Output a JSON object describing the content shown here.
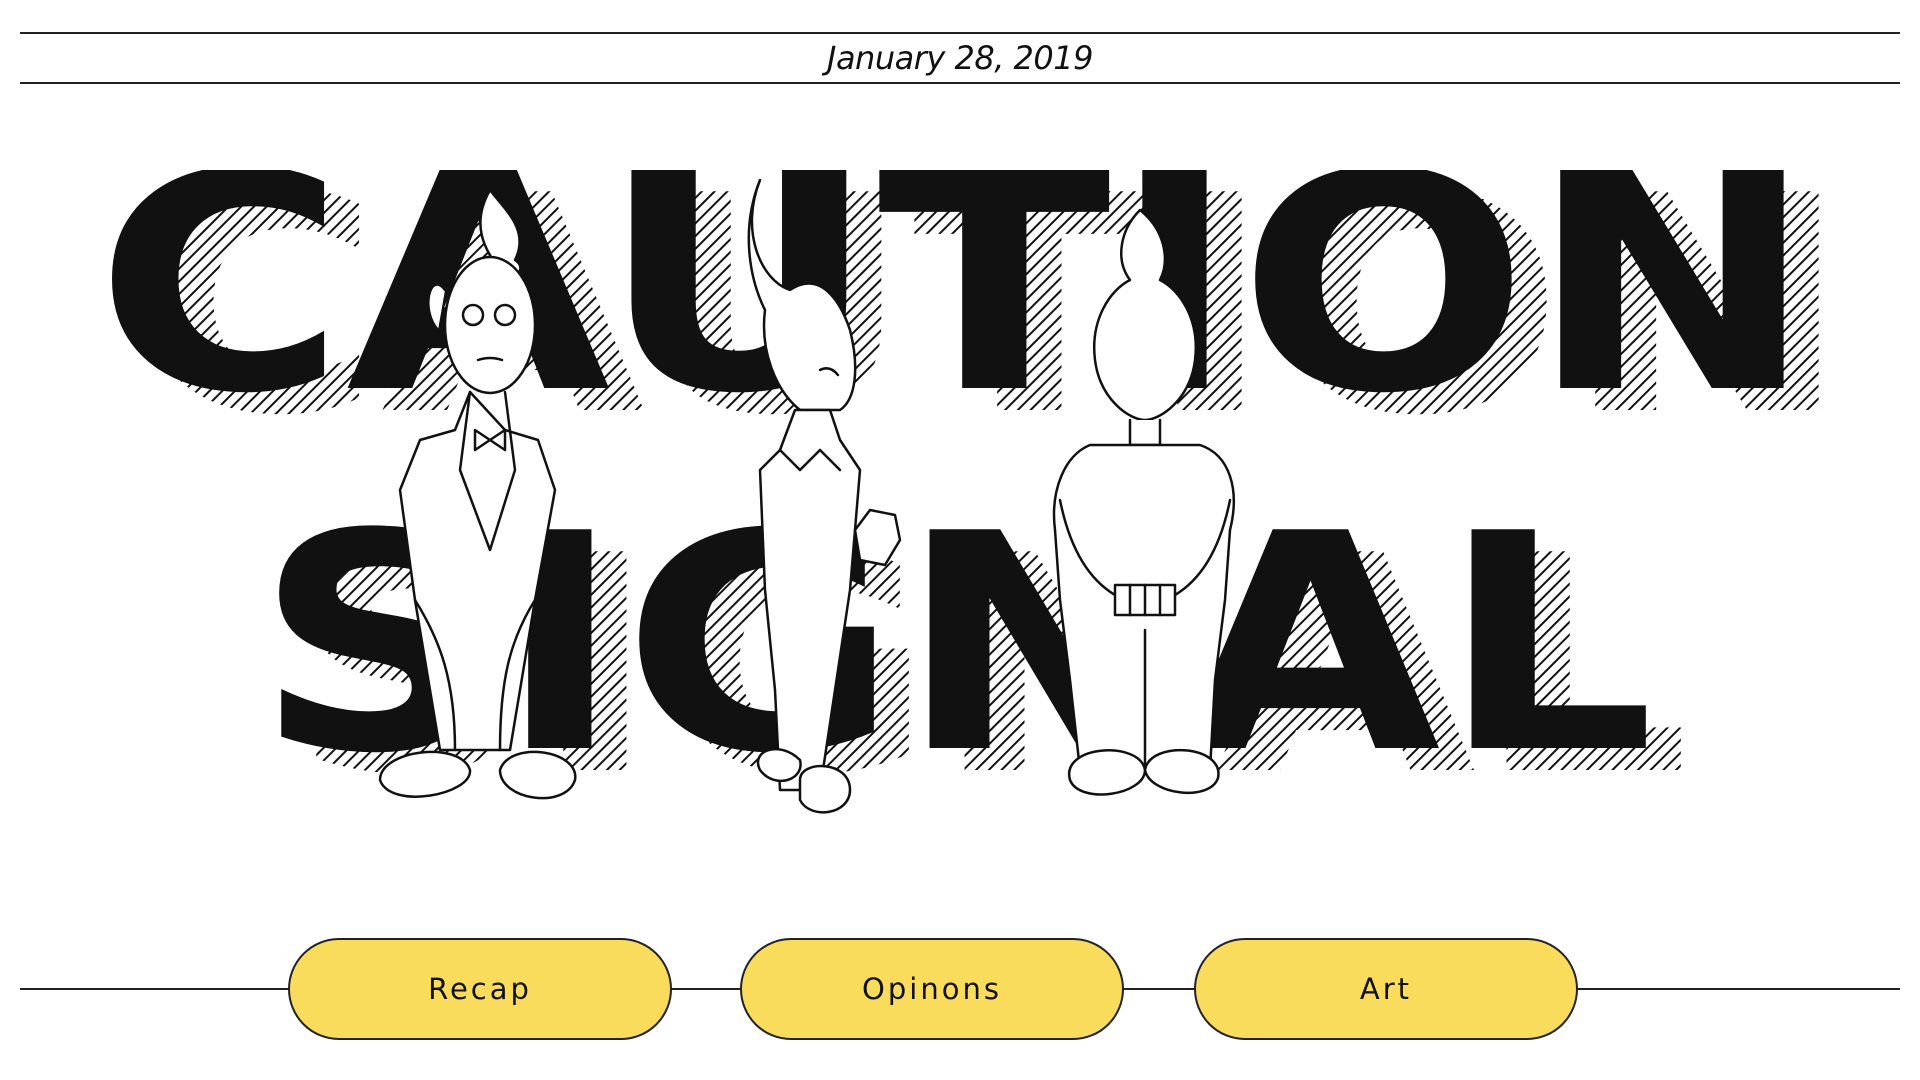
{
  "header": {
    "date": "January 28, 2019"
  },
  "masthead": {
    "title_line1": "CAUTION",
    "title_line2": "SIGNAL"
  },
  "nav": {
    "items": [
      {
        "label": "Recap"
      },
      {
        "label": "Opinons"
      },
      {
        "label": "Art"
      }
    ]
  },
  "colors": {
    "button_fill": "#f9dc5c",
    "ink": "#111111",
    "background": "#ffffff"
  }
}
